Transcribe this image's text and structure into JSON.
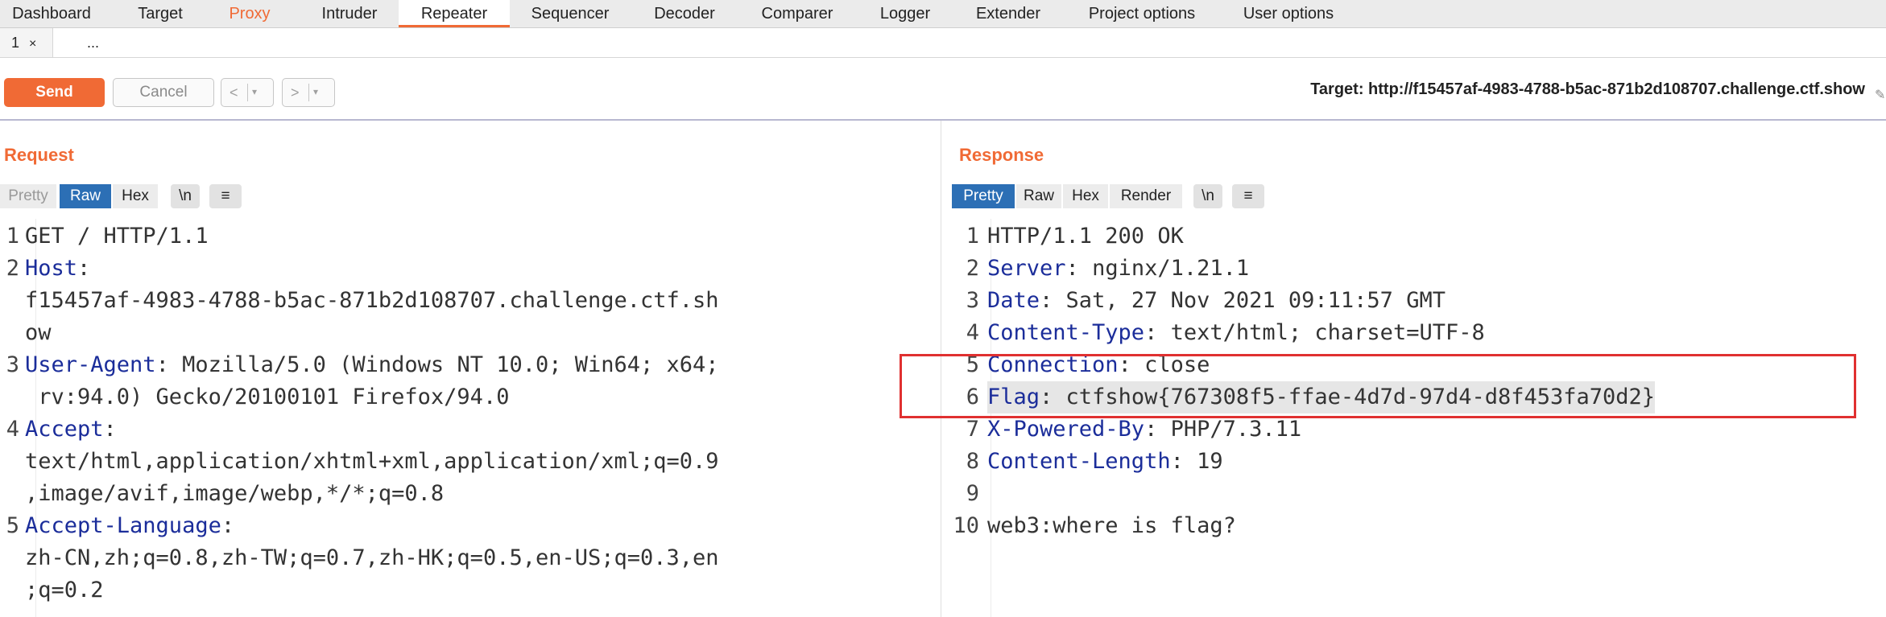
{
  "nav": {
    "tabs": [
      "Dashboard",
      "Target",
      "Proxy",
      "Intruder",
      "Repeater",
      "Sequencer",
      "Decoder",
      "Comparer",
      "Logger",
      "Extender",
      "Project options",
      "User options"
    ]
  },
  "repeater_tabs": {
    "active_label": "1",
    "close": "×",
    "more": "..."
  },
  "toolbar": {
    "send": "Send",
    "cancel": "Cancel",
    "back_glyph": "<",
    "forward_glyph": ">",
    "dropdown_glyph": "▾",
    "target": "Target: http://f15457af-4983-4788-b5ac-871b2d108707.challenge.ctf.show"
  },
  "request": {
    "title": "Request",
    "view_tabs": [
      "Pretty",
      "Raw",
      "Hex",
      "\\n",
      "≡"
    ],
    "active_view": "Raw",
    "lines": [
      {
        "num": "1",
        "key": "",
        "sep": "",
        "val": "GET / HTTP/1.1"
      },
      {
        "num": "2",
        "key": "Host",
        "sep": ":",
        "val": ""
      },
      {
        "num": "",
        "key": "",
        "sep": "",
        "val": "f15457af-4983-4788-b5ac-871b2d108707.challenge.ctf.sh"
      },
      {
        "num": "",
        "key": "",
        "sep": "",
        "val": "ow"
      },
      {
        "num": "3",
        "key": "User-Agent",
        "sep": ":",
        "val": " Mozilla/5.0 (Windows NT 10.0; Win64; x64;"
      },
      {
        "num": "",
        "key": "",
        "sep": "",
        "val": " rv:94.0) Gecko/20100101 Firefox/94.0"
      },
      {
        "num": "4",
        "key": "Accept",
        "sep": ":",
        "val": ""
      },
      {
        "num": "",
        "key": "",
        "sep": "",
        "val": "text/html,application/xhtml+xml,application/xml;q=0.9"
      },
      {
        "num": "",
        "key": "",
        "sep": "",
        "val": ",image/avif,image/webp,*/*;q=0.8"
      },
      {
        "num": "5",
        "key": "Accept-Language",
        "sep": ":",
        "val": ""
      },
      {
        "num": "",
        "key": "",
        "sep": "",
        "val": "zh-CN,zh;q=0.8,zh-TW;q=0.7,zh-HK;q=0.5,en-US;q=0.3,en"
      },
      {
        "num": "",
        "key": "",
        "sep": "",
        "val": ";q=0.2"
      }
    ]
  },
  "response": {
    "title": "Response",
    "view_tabs": [
      "Pretty",
      "Raw",
      "Hex",
      "Render",
      "\\n",
      "≡"
    ],
    "active_view": "Pretty",
    "lines": [
      {
        "num": "1",
        "key": "",
        "sep": "",
        "val": "HTTP/1.1 200 OK"
      },
      {
        "num": "2",
        "key": "Server",
        "sep": ":",
        "val": " nginx/1.21.1"
      },
      {
        "num": "3",
        "key": "Date",
        "sep": ":",
        "val": " Sat, 27 Nov 2021 09:11:57 GMT"
      },
      {
        "num": "4",
        "key": "Content-Type",
        "sep": ":",
        "val": " text/html; charset=UTF-8"
      },
      {
        "num": "5",
        "key": "Connection",
        "sep": ":",
        "val": " close"
      },
      {
        "num": "6",
        "key": "Flag",
        "sep": ":",
        "val": " ctfshow{767308f5-ffae-4d7d-97d4-d8f453fa70d2}"
      },
      {
        "num": "7",
        "key": "X-Powered-By",
        "sep": ":",
        "val": " PHP/7.3.11"
      },
      {
        "num": "8",
        "key": "Content-Length",
        "sep": ":",
        "val": " 19"
      },
      {
        "num": "9",
        "key": "",
        "sep": "",
        "val": ""
      },
      {
        "num": "10",
        "key": "",
        "sep": "",
        "val": "web3:where is flag?"
      }
    ],
    "highlighted_line": "6"
  },
  "colors": {
    "accent": "#f06a35",
    "active_tab": "#2c6fb5",
    "header_key": "#1b2d9a",
    "flag_box": "#e03030"
  }
}
